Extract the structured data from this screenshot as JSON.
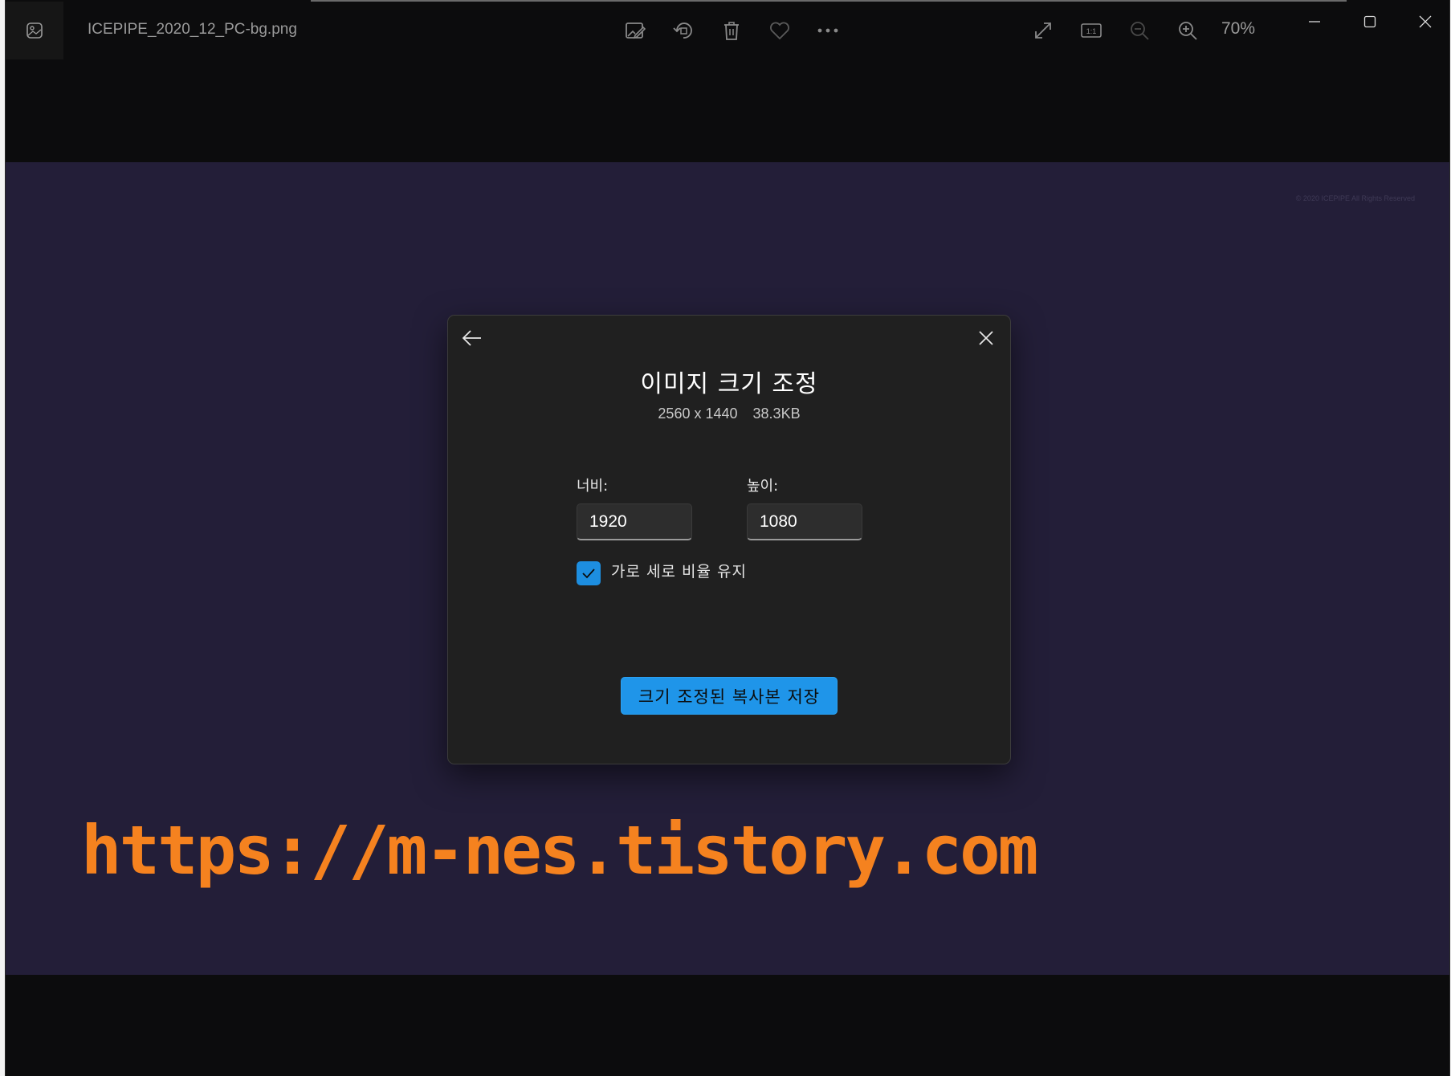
{
  "titlebar": {
    "file_name": "ICEPIPE_2020_12_PC-bg.png",
    "zoom_level": "70%"
  },
  "toolbar": {
    "icons": [
      "edit-image-icon",
      "rotate-icon",
      "delete-icon",
      "favorite-heart-icon",
      "more-options-icon"
    ],
    "view_icons": [
      "fullscreen-icon",
      "actual-size-icon",
      "zoom-out-icon",
      "zoom-in-icon"
    ]
  },
  "window_controls": [
    "minimize-icon",
    "maximize-icon",
    "close-icon"
  ],
  "image": {
    "copyright": "© 2020 ICEPIPE All Rights Reserved",
    "watermark_text": "https://m-nes.tistory.com",
    "background_color": "#231e38",
    "watermark_color": "#f5821f"
  },
  "dialog": {
    "title": "이미지 크기 조정",
    "dimensions": "2560 x 1440",
    "file_size": "38.3KB",
    "width_label": "너비:",
    "width_value": "1920",
    "height_label": "높이:",
    "height_value": "1080",
    "keep_ratio_label": "가로 세로 비율 유지",
    "keep_ratio_checked": true,
    "save_button_label": "크기 조정된 복사본 저장",
    "accent_color": "#1f95e9"
  }
}
